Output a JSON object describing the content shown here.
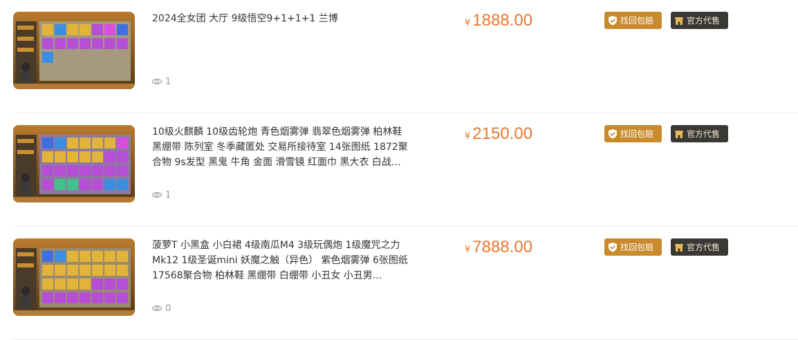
{
  "listings": [
    {
      "title": "2024全女团 大厅 9级悟空9+1+1+1 兰博",
      "views": "1",
      "currency": "¥",
      "price": "1888.00",
      "badges": {
        "guarantee": "找回包赔",
        "agent": "官方代售"
      }
    },
    {
      "title": "10级火麒麟 10级齿轮炮 青色烟雾弹 翡翠色烟雾弹 柏林鞋 黑绷带 陈列室 冬季藏匿处 交易所接待室 14张图纸 1872聚合物 9s发型 黑鬼 牛角 金面 滑雪镜 红面巾 黑大衣 白战神...",
      "views": "1",
      "currency": "¥",
      "price": "2150.00",
      "badges": {
        "guarantee": "找回包赔",
        "agent": "官方代售"
      }
    },
    {
      "title": "菠萝T 小黑盒 小白裙 4级南瓜M4 3级玩偶炮 1级魔咒之力 Mk12 1级圣诞mini 妖魔之触（异色） 紫色烟雾弹 6张图纸 17568聚合物 柏林鞋 黑绷带 白绷带 小丑女 小丑男...",
      "views": "0",
      "currency": "¥",
      "price": "7888.00",
      "badges": {
        "guarantee": "找回包赔",
        "agent": "官方代售"
      }
    }
  ],
  "colors": {
    "price": "#e8772e",
    "guarantee_badge": "#c88a2c",
    "agent_badge": "#3a3835",
    "separator": "#ececec"
  },
  "icons": {
    "views": "eye-icon",
    "guarantee": "shield-check-icon",
    "agent": "shop-icon"
  }
}
